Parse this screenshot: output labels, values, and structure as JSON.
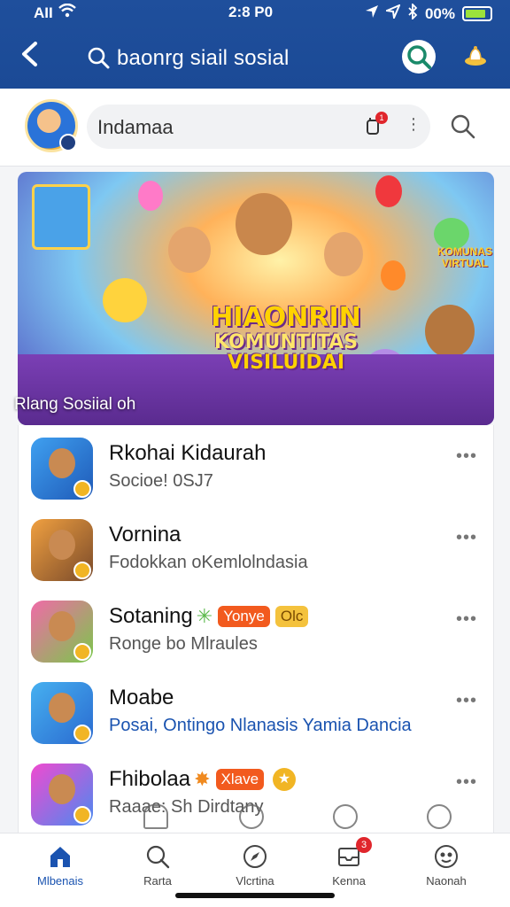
{
  "status_bar": {
    "carrier": "AII",
    "time": "2:8 P0",
    "battery_percent": "00%"
  },
  "header": {
    "back_label": "<",
    "search_title": "baonrg siail sosial"
  },
  "search": {
    "value": "Indamaa",
    "mic_badge_count": "1"
  },
  "banner": {
    "title_line1": "HIAONRIN",
    "title_line2": "KOMUNTITAS",
    "title_line3": "VISILUIDAI",
    "side_tag": "KOMUNAS VIRTUAL",
    "caption": "Rlang Sosiial oh"
  },
  "list": [
    {
      "title": "Rkohai Kidaurah",
      "subtitle": "Socioe! 0SJ7",
      "subtitle_style": "gray",
      "tags": []
    },
    {
      "title": "Vornina",
      "subtitle": "Fodokkan oKemlolndasia",
      "subtitle_style": "gray",
      "tags": []
    },
    {
      "title": "Sotaning",
      "subtitle": "Ronge bo Mlraules",
      "subtitle_style": "gray",
      "tags": [
        {
          "label": "Yonye",
          "style": "red"
        },
        {
          "label": "Olc",
          "style": "yellow"
        }
      ]
    },
    {
      "title": "Moabe",
      "subtitle": "Posai, Ontingo Nlanasis Yamia Dancia",
      "subtitle_style": "blue",
      "tags": []
    },
    {
      "title": "Fhibolaa",
      "subtitle": "Raaae: Sh Dirdtany",
      "subtitle_style": "gray",
      "tags": [
        {
          "label": "Xlave",
          "style": "red"
        }
      ]
    }
  ],
  "bottom_nav": [
    {
      "label": "Mlbenais",
      "icon": "home-icon",
      "active": true
    },
    {
      "label": "Rarta",
      "icon": "search-icon"
    },
    {
      "label": "Vlcrtina",
      "icon": "compass-icon"
    },
    {
      "label": "Kenna",
      "icon": "inbox-icon",
      "badge": "3"
    },
    {
      "label": "Naonah",
      "icon": "profile-icon"
    }
  ],
  "colors": {
    "header_bg": "#1b4a96",
    "accent_blue": "#1a53b0",
    "tag_red": "#f25a1e",
    "tag_yellow": "#f4c23d"
  }
}
